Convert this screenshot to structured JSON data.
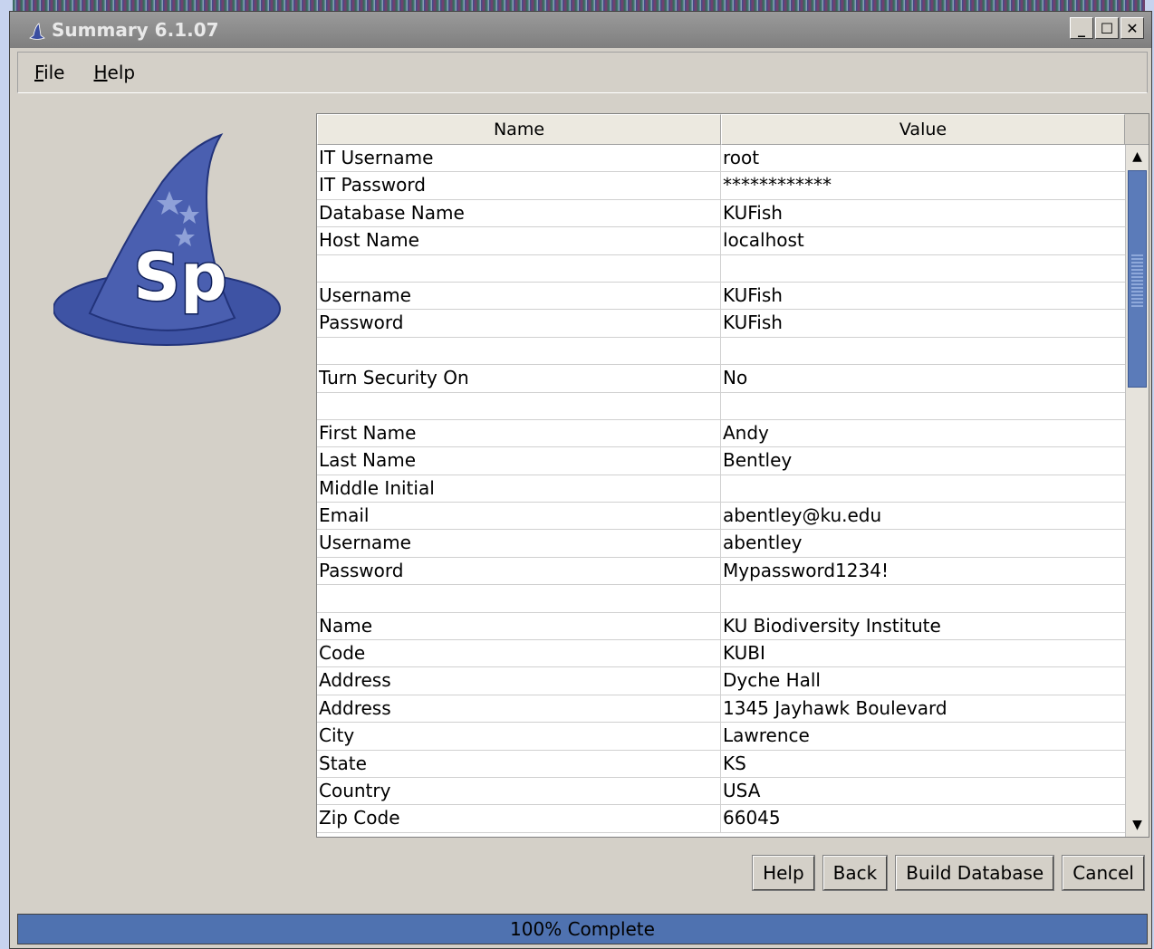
{
  "window": {
    "title": "Summary 6.1.07"
  },
  "menu": [
    {
      "label": "File",
      "mnemonic": "F",
      "rest": "ile"
    },
    {
      "label": "Help",
      "mnemonic": "H",
      "rest": "elp"
    }
  ],
  "logo": {
    "text": "Sp"
  },
  "table": {
    "headers": {
      "name": "Name",
      "value": "Value"
    },
    "rows": [
      {
        "name": "IT Username",
        "value": "root"
      },
      {
        "name": "IT Password",
        "value": "************"
      },
      {
        "name": "Database Name",
        "value": "KUFish"
      },
      {
        "name": "Host Name",
        "value": "localhost"
      },
      {
        "name": "",
        "value": ""
      },
      {
        "name": "Username",
        "value": "KUFish"
      },
      {
        "name": "Password",
        "value": "KUFish"
      },
      {
        "name": "",
        "value": ""
      },
      {
        "name": "Turn Security On",
        "value": "No"
      },
      {
        "name": "",
        "value": ""
      },
      {
        "name": "First Name",
        "value": "Andy"
      },
      {
        "name": "Last Name",
        "value": "Bentley"
      },
      {
        "name": "Middle Initial",
        "value": ""
      },
      {
        "name": "Email",
        "value": "abentley@ku.edu"
      },
      {
        "name": "Username",
        "value": "abentley"
      },
      {
        "name": "Password",
        "value": "Mypassword1234!"
      },
      {
        "name": "",
        "value": ""
      },
      {
        "name": "Name",
        "value": "KU Biodiversity Institute"
      },
      {
        "name": "Code",
        "value": "KUBI"
      },
      {
        "name": "Address",
        "value": "Dyche Hall"
      },
      {
        "name": "Address",
        "value": "1345 Jayhawk Boulevard"
      },
      {
        "name": "City",
        "value": "Lawrence"
      },
      {
        "name": "State",
        "value": "KS"
      },
      {
        "name": "Country",
        "value": "USA"
      },
      {
        "name": "Zip Code",
        "value": "66045"
      }
    ]
  },
  "buttons": {
    "help": "Help",
    "back": "Back",
    "build": "Build Database",
    "cancel": "Cancel"
  },
  "progress": {
    "text": "100% Complete",
    "fraction": 1.0
  },
  "colors": {
    "accent": "#4f72b0",
    "hat": "#4a5fb0"
  }
}
